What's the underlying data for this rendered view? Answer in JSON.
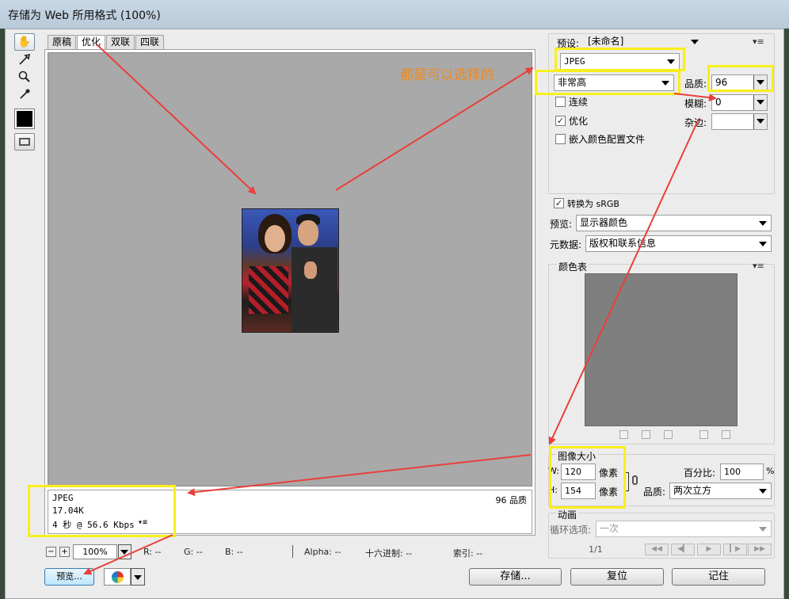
{
  "window": {
    "title": "存储为 Web 所用格式 (100%)"
  },
  "toolbox": {
    "tools": [
      "hand-icon",
      "slice-select-icon",
      "zoom-icon",
      "eyedropper-icon"
    ],
    "eyedropper_color": "#000000"
  },
  "tabs": [
    {
      "label": "原稿",
      "active": false
    },
    {
      "label": "优化",
      "active": true
    },
    {
      "label": "双联",
      "active": false
    },
    {
      "label": "四联",
      "active": false
    }
  ],
  "preview_info": {
    "format": "JPEG",
    "size": "17.04K",
    "download": "4 秒 @ 56.6 Kbps",
    "quality": "96 品质",
    "menu_icon": "▾≡"
  },
  "status_bar": {
    "zoom_minus": "−",
    "zoom_plus": "+",
    "zoom": "100%",
    "r": "R: --",
    "g": "G: --",
    "b": "B: --",
    "alpha": "Alpha: --",
    "hex": "十六进制: --",
    "index": "索引: --"
  },
  "buttons": {
    "preview": "预览...",
    "save": "存储...",
    "reset": "复位",
    "remember": "记住"
  },
  "settings": {
    "preset_label": "预设:",
    "preset_value": "[未命名]",
    "format": "JPEG",
    "quality_preset": "非常高",
    "quality_label": "品质:",
    "quality_value": "96",
    "blur_label": "模糊:",
    "blur_value": "0",
    "matte_label": "杂边:",
    "matte_value": "",
    "progressive_label": "连续",
    "progressive_checked": false,
    "optimized_label": "优化",
    "optimized_checked": true,
    "embed_profile_label": "嵌入颜色配置文件",
    "embed_profile_checked": false,
    "convert_srgb_label": "转换为 sRGB",
    "convert_srgb_checked": true,
    "preview_label": "预览:",
    "preview_value": "显示器颜色",
    "metadata_label": "元数据:",
    "metadata_value": "版权和联系信息"
  },
  "color_table": {
    "title": "颜色表",
    "fill": "#7f7f7f"
  },
  "image_size": {
    "title": "图像大小",
    "w_label": "W:",
    "w_value": "120",
    "w_unit": "像素",
    "h_label": "H:",
    "h_value": "154",
    "h_unit": "像素",
    "percent_label": "百分比:",
    "percent_value": "100",
    "percent_unit": "%",
    "quality_label": "品质:",
    "quality_value": "两次立方"
  },
  "animation": {
    "title": "动画",
    "loop_label": "循环选项:",
    "loop_value": "一次",
    "frame": "1/1"
  },
  "annotation": {
    "text": "都是可以选择的",
    "highlight_color": "#f8ef1a",
    "arrow_color": "#e8403a"
  }
}
